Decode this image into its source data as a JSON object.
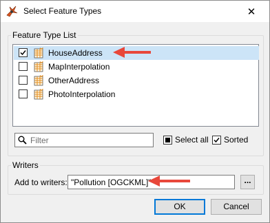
{
  "window": {
    "title": "Select Feature Types",
    "close_glyph": "✕"
  },
  "feature_type_list": {
    "legend": "Feature Type List",
    "items": [
      {
        "label": "HouseAddress",
        "checked": true,
        "selected": true
      },
      {
        "label": "MapInterpolation",
        "checked": false,
        "selected": false
      },
      {
        "label": "OtherAddress",
        "checked": false,
        "selected": false
      },
      {
        "label": "PhotoInterpolation",
        "checked": false,
        "selected": false
      }
    ]
  },
  "filter": {
    "placeholder": "Filter",
    "icon": "search-icon"
  },
  "options": {
    "select_all_label": "Select all",
    "select_all_checked": false,
    "sorted_label": "Sorted",
    "sorted_checked": true
  },
  "writers": {
    "legend": "Writers",
    "add_to_label": "Add to writers:",
    "value": "\"Pollution [OGCKML]\"",
    "browse_label": "..."
  },
  "buttons": {
    "ok": "OK",
    "cancel": "Cancel"
  },
  "colors": {
    "selection": "#cce4f7",
    "annotation_arrow": "#e8473a",
    "focus_border": "#0078d7",
    "feature_icon": "#e08b1d"
  }
}
